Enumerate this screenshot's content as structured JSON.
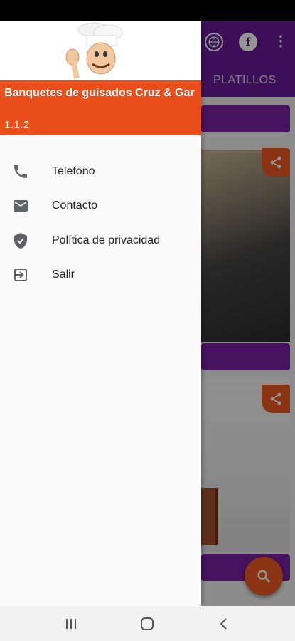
{
  "toolbar": {
    "more_glyph": "⋮"
  },
  "tabs": [
    {
      "label": "PLATILLOS"
    }
  ],
  "drawer": {
    "app_title": "Banquetes de guisados Cruz & Gar",
    "app_version": "1.1.2",
    "items": [
      {
        "label": "Telefono",
        "icon": "phone-icon"
      },
      {
        "label": "Contacto",
        "icon": "mail-icon"
      },
      {
        "label": "Política de privacidad",
        "icon": "shield-icon"
      },
      {
        "label": "Salir",
        "icon": "exit-icon"
      }
    ]
  },
  "colors": {
    "primary": "#6a1b9a",
    "accent": "#f05a24",
    "header": "#e94e1b"
  }
}
